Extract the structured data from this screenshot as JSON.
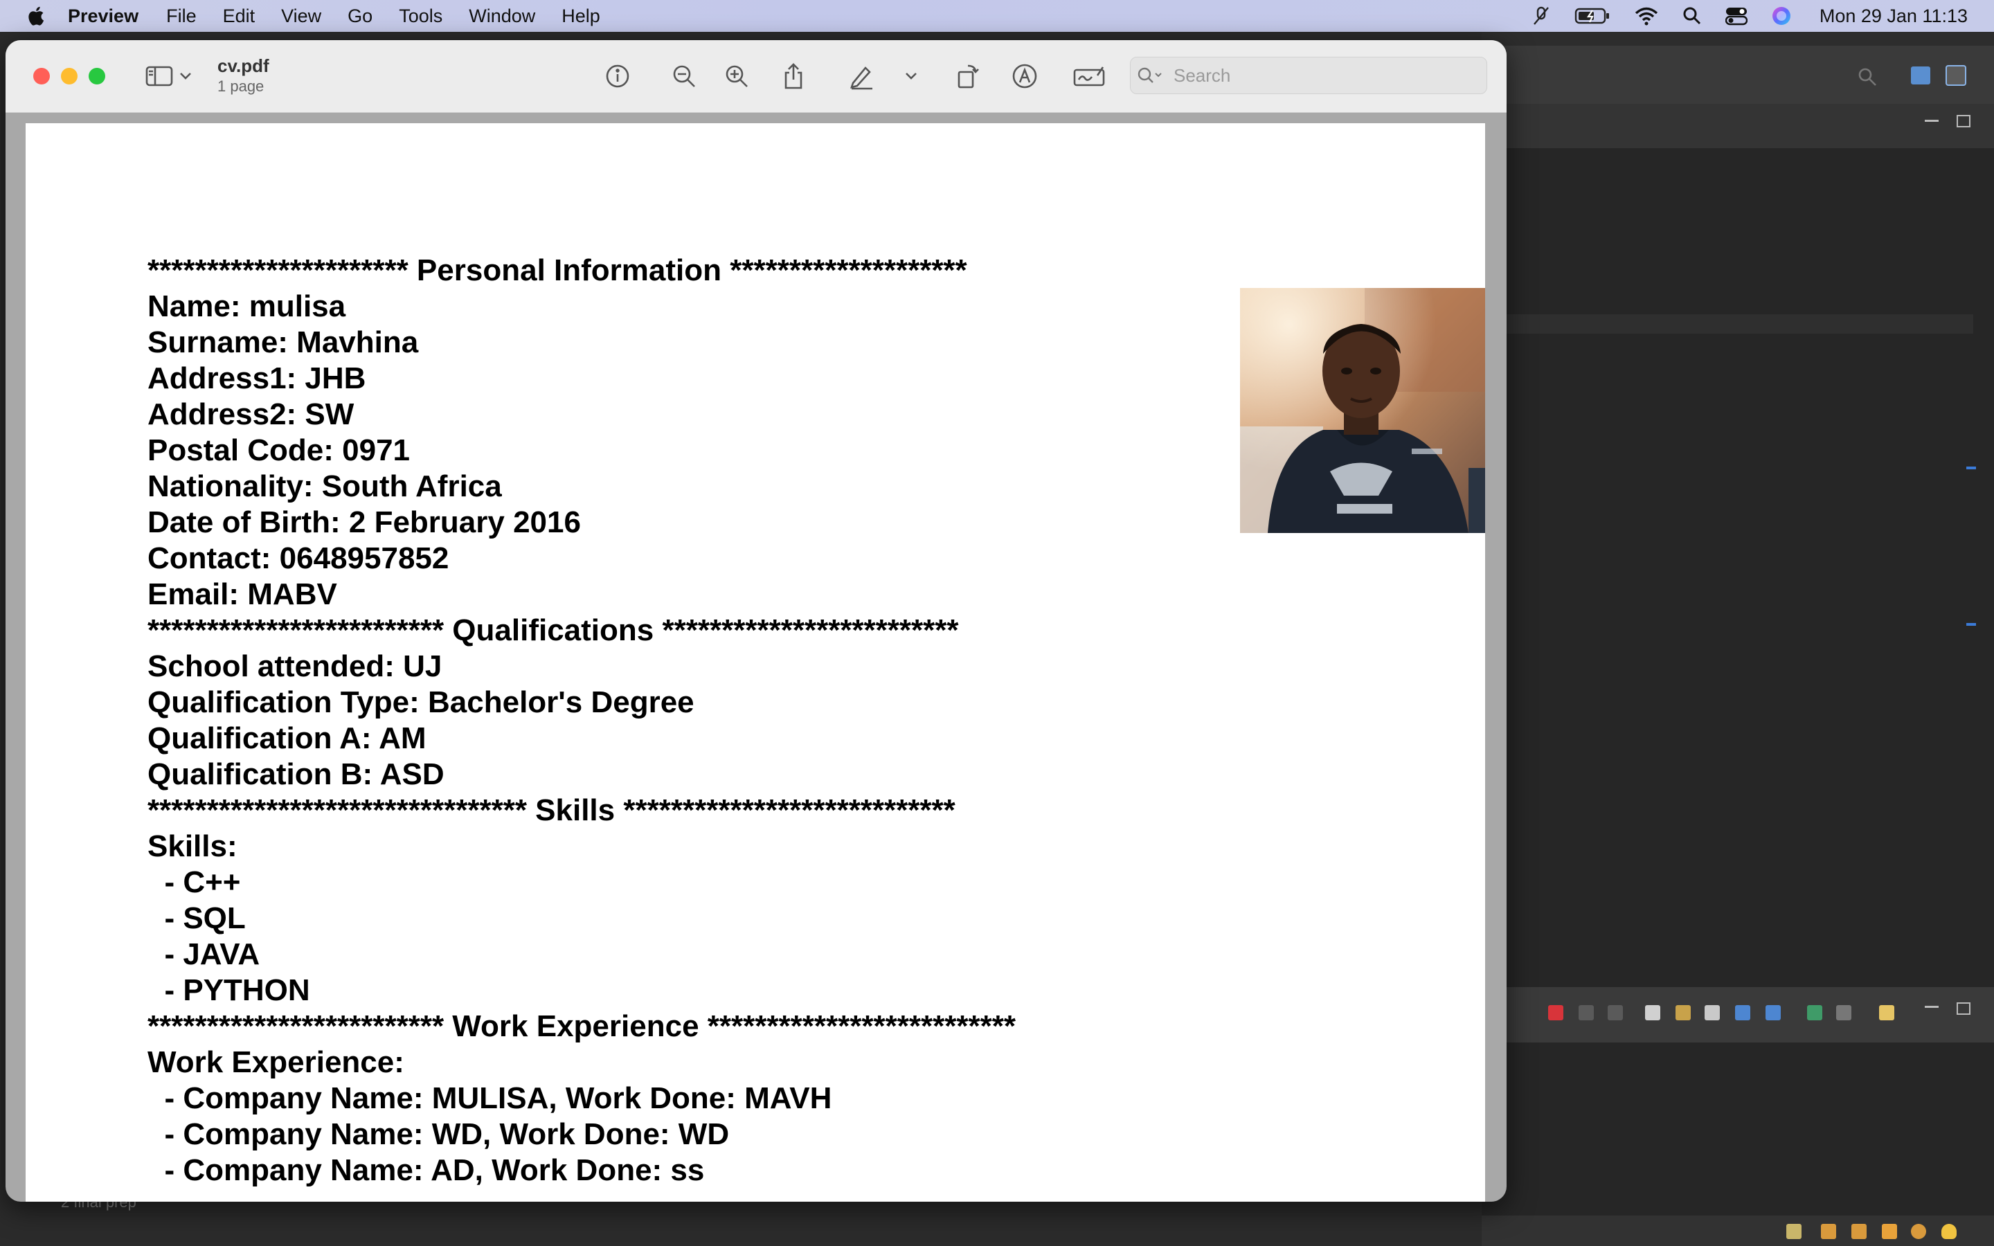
{
  "menubar": {
    "app_name": "Preview",
    "items": [
      "File",
      "Edit",
      "View",
      "Go",
      "Tools",
      "Window",
      "Help"
    ],
    "clock": "Mon 29 Jan  11:13",
    "status_icons": [
      "mic-muted-icon",
      "battery-charging-icon",
      "wifi-icon",
      "spotlight-search-icon",
      "control-center-icon",
      "siri-icon"
    ]
  },
  "window": {
    "doc_title": "cv.pdf",
    "doc_subtitle": "1 page",
    "search_placeholder": "Search"
  },
  "document": {
    "lines": [
      "********************** Personal Information ********************",
      "Name: mulisa",
      "Surname: Mavhina",
      "Address1: JHB",
      "Address2: SW",
      "Postal Code: 0971",
      "Nationality: South Africa",
      "Date of Birth: 2 February 2016",
      "Contact: 0648957852",
      "Email: MABV",
      "************************* Qualifications *************************",
      "School attended: UJ",
      "Qualification Type: Bachelor's Degree",
      "Qualification A: AM",
      "Qualification B: ASD",
      "******************************** Skills ****************************",
      "Skills:",
      "  - C++",
      "  - SQL",
      "  - JAVA",
      "  - PYTHON",
      "************************* Work Experience **************************",
      "Work Experience:",
      "  - Company Name: MULISA, Work Done: MAVH",
      "  - Company Name: WD, Work Done: WD",
      "  - Company Name: AD, Work Done: ss"
    ]
  },
  "background_app": {
    "status_text": "2 final prep"
  },
  "colors": {
    "menubar": "#c6cbe9",
    "window_close": "#ff5f57",
    "window_minimize": "#febc2e",
    "window_zoom": "#28c840",
    "ide_background": "#2d2d2d"
  }
}
